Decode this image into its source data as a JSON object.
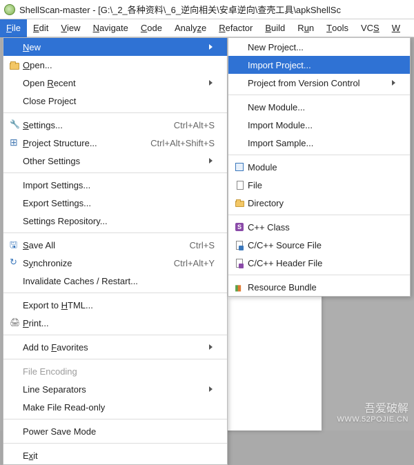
{
  "titlebar": {
    "title": "ShellScan-master - [G:\\_2_各种资料\\_6_逆向相关\\安卓逆向\\查壳工具\\apkShellSc"
  },
  "menubar": {
    "items": [
      {
        "label": "File",
        "mnemonic": "F",
        "active": true
      },
      {
        "label": "Edit",
        "mnemonic": "E"
      },
      {
        "label": "View",
        "mnemonic": "V"
      },
      {
        "label": "Navigate",
        "mnemonic": "N"
      },
      {
        "label": "Code",
        "mnemonic": "C"
      },
      {
        "label": "Analyze",
        "mnemonic": "z"
      },
      {
        "label": "Refactor",
        "mnemonic": "R"
      },
      {
        "label": "Build",
        "mnemonic": "B"
      },
      {
        "label": "Run",
        "mnemonic": "u"
      },
      {
        "label": "Tools",
        "mnemonic": "T"
      },
      {
        "label": "VCS",
        "mnemonic": "S"
      },
      {
        "label": "W",
        "mnemonic": "W"
      }
    ]
  },
  "file_menu": {
    "items": [
      {
        "label": "New",
        "mnemonic": "N",
        "submenu": true,
        "selected": true
      },
      {
        "label": "Open...",
        "mnemonic": "O",
        "icon": "folder-icon"
      },
      {
        "label": "Open Recent",
        "mnemonic": "R",
        "submenu": true
      },
      {
        "label": "Close Project",
        "mnemonic": "j"
      },
      {
        "sep": true
      },
      {
        "label": "Settings...",
        "mnemonic": "S",
        "icon": "wrench-icon",
        "shortcut": "Ctrl+Alt+S"
      },
      {
        "label": "Project Structure...",
        "mnemonic": "P",
        "icon": "structure-icon",
        "shortcut": "Ctrl+Alt+Shift+S"
      },
      {
        "label": "Other Settings",
        "submenu": true
      },
      {
        "sep": true
      },
      {
        "label": "Import Settings..."
      },
      {
        "label": "Export Settings..."
      },
      {
        "label": "Settings Repository..."
      },
      {
        "sep": true
      },
      {
        "label": "Save All",
        "mnemonic": "S",
        "icon": "disk-icon",
        "shortcut": "Ctrl+S"
      },
      {
        "label": "Synchronize",
        "mnemonic": "y",
        "icon": "sync-icon",
        "shortcut": "Ctrl+Alt+Y"
      },
      {
        "label": "Invalidate Caches / Restart..."
      },
      {
        "sep": true
      },
      {
        "label": "Export to HTML...",
        "mnemonic": "H"
      },
      {
        "label": "Print...",
        "mnemonic": "P",
        "icon": "print-icon"
      },
      {
        "sep": true
      },
      {
        "label": "Add to Favorites",
        "mnemonic": "F",
        "submenu": true
      },
      {
        "sep": true
      },
      {
        "label": "File Encoding",
        "disabled": true
      },
      {
        "label": "Line Separators",
        "submenu": true
      },
      {
        "label": "Make File Read-only"
      },
      {
        "sep": true
      },
      {
        "label": "Power Save Mode"
      },
      {
        "sep": true
      },
      {
        "label": "Exit",
        "mnemonic": "x"
      }
    ]
  },
  "new_menu": {
    "items": [
      {
        "label": "New Project..."
      },
      {
        "label": "Import Project...",
        "selected": true
      },
      {
        "label": "Project from Version Control",
        "submenu": true
      },
      {
        "sep": true
      },
      {
        "label": "New Module..."
      },
      {
        "label": "Import Module..."
      },
      {
        "label": "Import Sample..."
      },
      {
        "sep": true
      },
      {
        "label": "Module",
        "icon": "module-icon"
      },
      {
        "label": "File",
        "icon": "file-icon"
      },
      {
        "label": "Directory",
        "icon": "directory-icon"
      },
      {
        "sep": true
      },
      {
        "label": "C++ Class",
        "icon": "scala-icon"
      },
      {
        "label": "C/C++ Source File",
        "icon": "cpp-source-icon"
      },
      {
        "label": "C/C++ Header File",
        "icon": "cpp-header-icon"
      },
      {
        "sep": true
      },
      {
        "label": "Resource Bundle",
        "icon": "bundle-icon"
      }
    ]
  },
  "watermark": {
    "line1": "吾爱破解",
    "line2": "WWW.52POJIE.CN"
  }
}
